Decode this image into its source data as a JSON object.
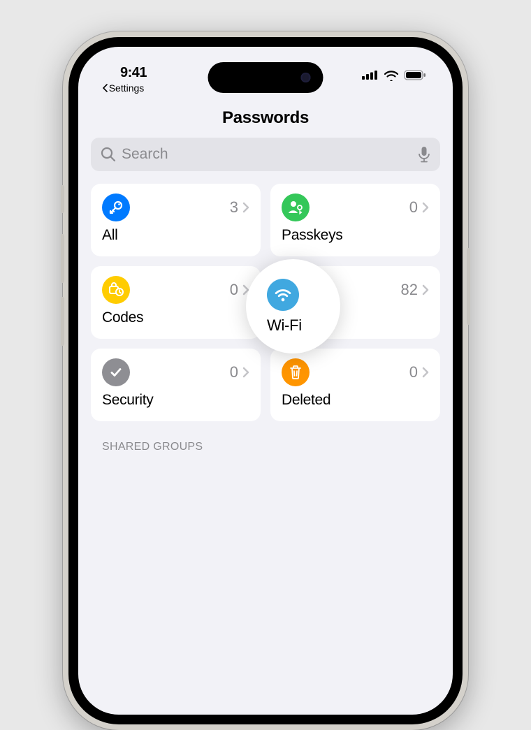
{
  "status": {
    "time": "9:41",
    "back_label": "Settings"
  },
  "header": {
    "title": "Passwords"
  },
  "search": {
    "placeholder": "Search"
  },
  "tiles": {
    "all": {
      "label": "All",
      "count": "3"
    },
    "passkeys": {
      "label": "Passkeys",
      "count": "0"
    },
    "codes": {
      "label": "Codes",
      "count": "0"
    },
    "wifi": {
      "label": "Wi-Fi",
      "count": "82"
    },
    "security": {
      "label": "Security",
      "count": "0"
    },
    "deleted": {
      "label": "Deleted",
      "count": "0"
    }
  },
  "sections": {
    "shared_groups": "SHARED GROUPS"
  },
  "colors": {
    "all": "#007aff",
    "passkeys": "#34c759",
    "codes": "#ffcc00",
    "wifi": "#40a8e0",
    "security": "#8e8e93",
    "deleted": "#ff9500"
  }
}
